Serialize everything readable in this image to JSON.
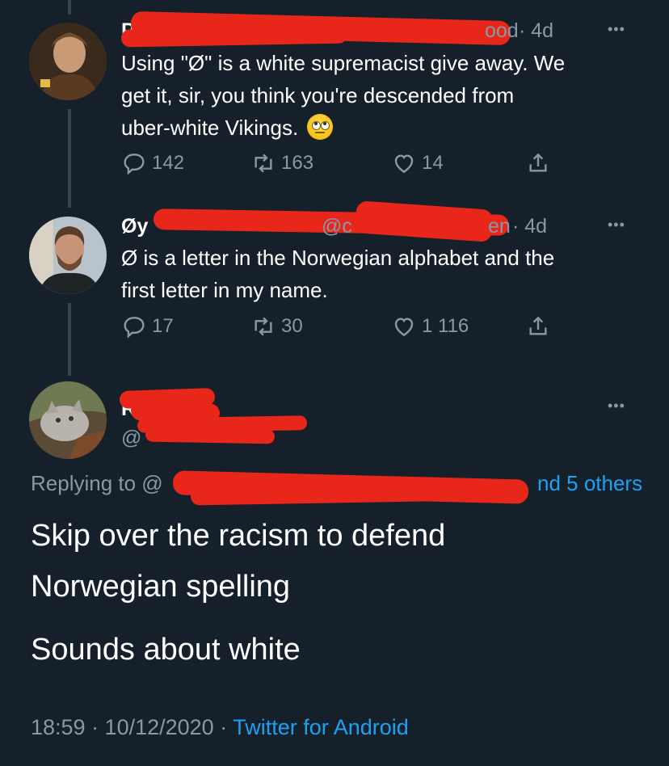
{
  "tweet1": {
    "name": "P",
    "handle_end": "ood",
    "time": "· 4d",
    "more": "•••",
    "text_l1": "Using \"Ø\" is a white supremacist give away.  We",
    "text_l2": "get it, sir, you think you're descended from",
    "text_l3": "uber-white Vikings.",
    "emoji": "face-with-rolling-eyes",
    "replies": "142",
    "retweets": "163",
    "likes": "14"
  },
  "tweet2": {
    "name": "Øy",
    "handle_mid": "@c",
    "handle_end": "en",
    "time": "· 4d",
    "more": "•••",
    "text_l1": "Ø is a letter in the Norwegian alphabet and the",
    "text_l2": "first letter in my name.",
    "replies": "17",
    "retweets": "30",
    "likes": "1 116"
  },
  "main_tweet": {
    "name": "R",
    "handle": "@",
    "more": "•••",
    "replying_label": "Replying to @",
    "replying_others": "nd 5 others",
    "line1": "Skip over the racism to defend",
    "line2": "Norwegian spelling",
    "line3": "Sounds about white",
    "time": "18:59 · 10/12/2020 · ",
    "source": "Twitter for Android"
  },
  "colors": {
    "background": "#15202b",
    "muted": "#8899a6",
    "link": "#1da1f2",
    "redaction": "#e8271a"
  }
}
